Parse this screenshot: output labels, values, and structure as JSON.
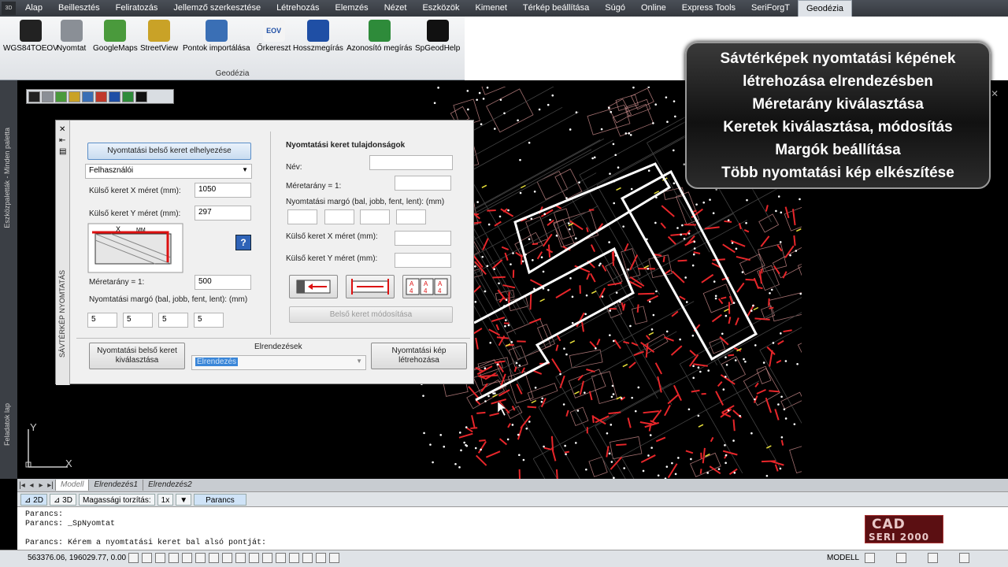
{
  "menu": [
    "Alap",
    "Beillesztés",
    "Feliratozás",
    "Jellemző szerkesztése",
    "Létrehozás",
    "Elemzés",
    "Nézet",
    "Eszközök",
    "Kimenet",
    "Térkép beállítása",
    "Súgó",
    "Online",
    "Express Tools",
    "SeriForgT",
    "Geodézia"
  ],
  "app_badge": "3D",
  "ribbon": {
    "group_label": "Geodézia",
    "buttons": [
      {
        "label": "WGS84TOEOV",
        "icon": "globe-icon",
        "color": "#222"
      },
      {
        "label": "Nyomtat",
        "icon": "printer-icon",
        "color": "#8a8f96"
      },
      {
        "label": "GoogleMaps",
        "icon": "google-maps-icon",
        "color": "#4a9a3c"
      },
      {
        "label": "StreetView",
        "icon": "street-view-icon",
        "color": "#c9a227"
      },
      {
        "label": "Pontok importálása",
        "icon": "points-import-icon",
        "color": "#3a6fb5"
      },
      {
        "label": "Őrkereszt",
        "icon": "eov-cross-icon",
        "color": "#c0392b"
      },
      {
        "label": "Hosszmegírás",
        "icon": "length-label-icon",
        "color": "#1f4fa5"
      },
      {
        "label": "Azonosító megírás",
        "icon": "id-label-icon",
        "color": "#2e8b3a"
      },
      {
        "label": "SpGeodHelp",
        "icon": "help-icon",
        "color": "#111"
      }
    ],
    "eov_text": "EOV"
  },
  "left_strip": {
    "palette_label": "Eszközpaletták - Minden paletta",
    "tasks_label": "Feladatok lap"
  },
  "overlay": {
    "lines": [
      "Sávtérképek nyomtatási képének",
      "létrehozása elrendezésben",
      "Méretarány kiválasztása",
      "Keretek kiválasztása, módosítás",
      "Margók beállítása",
      "Több nyomtatási kép elkészítése"
    ]
  },
  "dialog": {
    "strip_title": "SÁVTÉRKÉP NYOMTATÁS",
    "place_inner_frame_button": "Nyomtatási belső keret elhelyezése",
    "frame_type_select": "Felhasználói",
    "outer_x_label": "Külső keret X méret (mm):",
    "outer_x_value": "1050",
    "outer_y_label": "Külső keret Y méret (mm):",
    "outer_y_value": "297",
    "scale_label": "Méretarány = 1:",
    "scale_value": "500",
    "margin_label": "Nyomtatási margó (bal, jobb, fent, lent): (mm)",
    "margins": [
      "5",
      "5",
      "5",
      "5"
    ],
    "props_title": "Nyomtatási keret tulajdonságok",
    "name_label": "Név:",
    "props_scale_label": "Méretarány = 1:",
    "props_margin_label": "Nyomtatási margó (bal, jobb, fent, lent): (mm)",
    "props_outer_x_label": "Külső keret X méret (mm):",
    "props_outer_y_label": "Külső keret Y méret (mm):",
    "modify_inner_button": "Belső keret módosítása",
    "select_inner_button": "Nyomtatási belső keret kiválasztása",
    "layouts_label": "Elrendezések",
    "layouts_value": "Elrendezés",
    "create_image_button": "Nyomtatási kép létrehozása",
    "diagram_x": "X",
    "diagram_mm": "MM",
    "aa_glyph": "A",
    "four_glyph": "4"
  },
  "tabs": [
    "Modell",
    "Elrendezés1",
    "Elrendezés2"
  ],
  "viewbar": {
    "mode2d": "2D",
    "mode3d": "3D",
    "exaggeration_label": "Magassági torzítás:",
    "exaggeration_value": "1x",
    "command_label": "Parancs"
  },
  "ucs": {
    "x": "X",
    "y": "Y"
  },
  "cmdline": [
    "Parancs:",
    "Parancs: _SpNyomtat",
    "",
    "Parancs: Kérem a nyomtatási keret bal alsó pontját:"
  ],
  "statusbar": {
    "coords": "563376.06, 196029.77, 0.00",
    "mode": "MODELL"
  },
  "logo": {
    "line1": "CAD",
    "line2": "SERI 2000"
  },
  "colors": {
    "frame_white": "#ffffff",
    "network_red": "#e8262a",
    "network_pink": "#e8a0a0",
    "dots": "#ffffff",
    "accent_yellow": "#e8e03a"
  }
}
